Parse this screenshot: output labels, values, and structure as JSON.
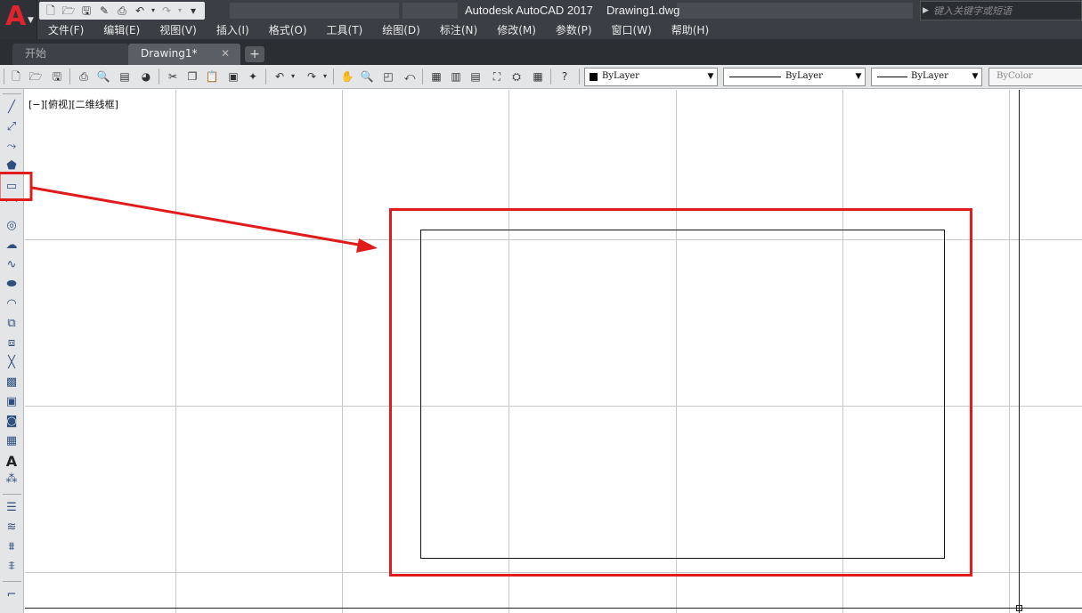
{
  "titlebar": {
    "app_logo": "A",
    "app_name": "Autodesk AutoCAD 2017",
    "file_name": "Drawing1.dwg",
    "search_placeholder": "键入关键字或短语",
    "qat_icons": [
      "new-icon",
      "open-icon",
      "save-icon",
      "save-as-icon",
      "print-icon",
      "undo-icon",
      "redo-icon",
      "customize-icon"
    ]
  },
  "menu": {
    "items": [
      "文件(F)",
      "编辑(E)",
      "视图(V)",
      "插入(I)",
      "格式(O)",
      "工具(T)",
      "绘图(D)",
      "标注(N)",
      "修改(M)",
      "参数(P)",
      "窗口(W)",
      "帮助(H)"
    ]
  },
  "tabs": {
    "start": "开始",
    "active": "Drawing1*",
    "close": "✕",
    "add": "+"
  },
  "properties": {
    "layer_color": "ByLayer",
    "linetype": "ByLayer",
    "lineweight": "ByLayer",
    "plot_style": "ByColor"
  },
  "canvas": {
    "viewport_label": "[−][俯视][二维线框]"
  },
  "left_toolbar": {
    "tools": [
      "line-icon",
      "construction-line-icon",
      "polyline-icon",
      "polygon-icon",
      "rectangle-icon",
      "arc-icon",
      "circle-icon",
      "revision-cloud-icon",
      "spline-icon",
      "ellipse-icon",
      "ellipse-arc-icon",
      "insert-block-icon",
      "make-block-icon",
      "point-icon",
      "hatch-icon",
      "gradient-icon",
      "region-icon",
      "table-icon",
      "multiline-text-icon",
      "add-selected-icon"
    ]
  },
  "colors": {
    "title_bg": "#3b3f45",
    "toolbar_bg": "#e4e5e7",
    "highlight": "#e01b1b",
    "grid": "#c8c8c8",
    "logo_red": "#e0242e"
  }
}
